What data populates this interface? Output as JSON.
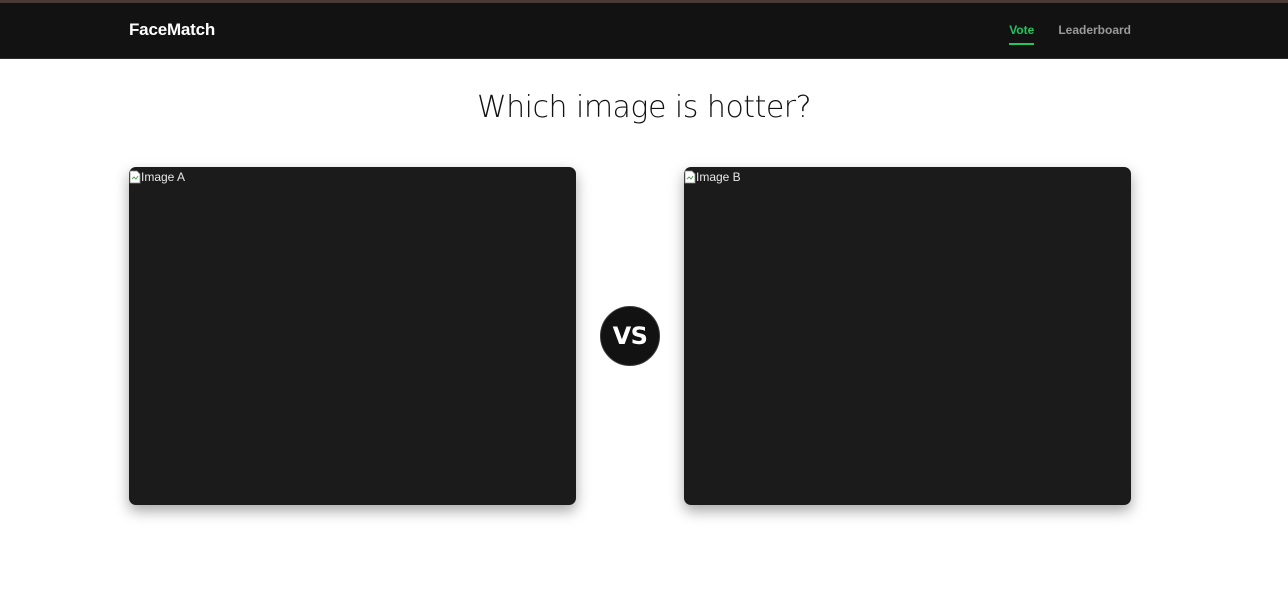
{
  "app": {
    "brand": "FaceMatch"
  },
  "nav": {
    "items": [
      {
        "label": "Vote",
        "active": true
      },
      {
        "label": "Leaderboard",
        "active": false
      }
    ]
  },
  "main": {
    "headline": "Which image is hotter?",
    "image_a": {
      "alt": "Image A"
    },
    "image_b": {
      "alt": "Image B"
    },
    "vs_label": "VS"
  },
  "colors": {
    "nav_background": "#121212",
    "accent": "#22c55e",
    "card_background": "#1b1b1b"
  }
}
